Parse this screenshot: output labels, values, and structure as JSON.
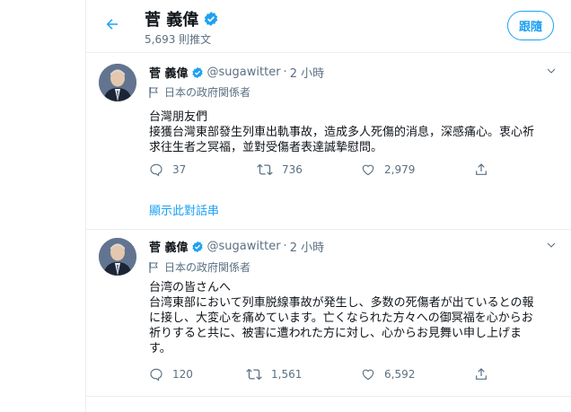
{
  "header": {
    "name": "菅 義偉",
    "tweet_count": "5,693 則推文",
    "follow_label": "跟隨"
  },
  "colors": {
    "accent": "#1da1f2",
    "text": "#0f1419",
    "muted": "#5b7083",
    "border": "#ebeef0"
  },
  "tweets": [
    {
      "name": "菅 義偉",
      "handle": "@sugawitter",
      "sep": "·",
      "time": "2 小時",
      "label": "日本の政府関係者",
      "lines": [
        "台灣朋友們",
        "接獲台灣東部發生列車出軌事故，造成多人死傷的消息，深感痛心。衷心祈",
        "求往生者之冥福，並對受傷者表達誠摯慰問。"
      ],
      "replies": "37",
      "retweets": "736",
      "likes": "2,979",
      "thread_link": "顯示此對話串"
    },
    {
      "name": "菅 義偉",
      "handle": "@sugawitter",
      "sep": "·",
      "time": "2 小時",
      "label": "日本の政府関係者",
      "lines": [
        "台湾の皆さんへ",
        "台湾東部において列車脱線事故が発生し、多数の死傷者が出ているとの報",
        "に接し、大変心を痛めています。亡くなられた方々への御冥福を心からお",
        "祈りすると共に、被害に遭われた方に対し、心からお見舞い申し上げま",
        "す。"
      ],
      "replies": "120",
      "retweets": "1,561",
      "likes": "6,592"
    }
  ]
}
